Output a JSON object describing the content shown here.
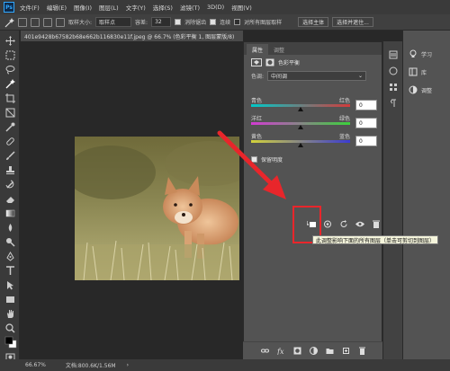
{
  "app": {
    "menus": [
      "文件(F)",
      "编辑(E)",
      "图像(I)",
      "图层(L)",
      "文字(Y)",
      "选择(S)",
      "滤镜(T)",
      "3D(D)",
      "视图(V)"
    ]
  },
  "options": {
    "sample_size_label": "取样大小:",
    "sample_size_value": "取样点",
    "tolerance_label": "容差:",
    "tolerance_value": "32",
    "antialias_label": "消除锯齿",
    "contiguous_label": "连续",
    "all_layers_label": "对所有图层取样",
    "select_subject_label": "选择主体",
    "select_and_mask_label": "选择并遮住..."
  },
  "document": {
    "tab_title": "401e9428b67582b68e662b116830e11f.jpeg @ 66.7% (色彩平衡 1, 图层蒙版/8)"
  },
  "status": {
    "zoom": "66.67%",
    "doc_info": "文档:800.6K/1.56M"
  },
  "properties_panel": {
    "tab_properties": "属性",
    "tab_adjustments": "调整",
    "adjustment_title": "色彩平衡",
    "tone_label": "色调:",
    "tone_value": "中间调",
    "sliders": [
      {
        "left": "青色",
        "right": "红色",
        "value": "0",
        "level": 0.5
      },
      {
        "left": "洋红",
        "right": "绿色",
        "value": "0",
        "level": 0.5
      },
      {
        "left": "黄色",
        "right": "蓝色",
        "value": "0",
        "level": 0.5
      }
    ],
    "preserve_luminosity_label": "保留明度",
    "tooltip": "此调整影响下面的所有图层（单击可剪切到图层）"
  },
  "right_dock": {
    "learn_label": "学习",
    "libraries_label": "库",
    "adjustments_label": "调整"
  },
  "colors": {
    "highlight": "#e8262b",
    "arrow": "#e8262b",
    "accent": "#31a8ff"
  }
}
